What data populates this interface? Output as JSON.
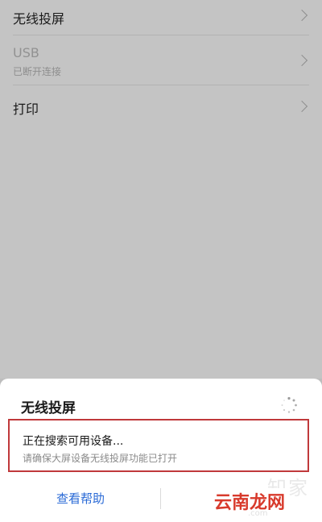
{
  "settings": {
    "items": [
      {
        "label": "无线投屏",
        "sublabel": ""
      },
      {
        "label": "USB",
        "sublabel": "已断开连接"
      },
      {
        "label": "打印",
        "sublabel": ""
      }
    ]
  },
  "sheet": {
    "title": "无线投屏",
    "status_main": "正在搜索可用设备...",
    "status_sub": "请确保大屏设备无线投屏功能已打开",
    "help_label": "查看帮助"
  },
  "watermark": {
    "top_text": "知家",
    "main_text": "云南龙网",
    "url_text": ".com"
  },
  "colors": {
    "highlight": "#c0393b",
    "link": "#2a6ad6",
    "watermark": "#d83a2c"
  },
  "icons": [
    "chevron-right-icon",
    "loading-spinner-icon"
  ]
}
